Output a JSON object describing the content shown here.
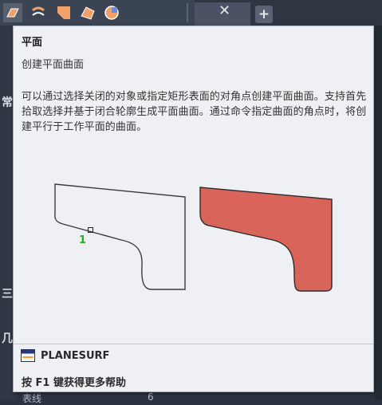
{
  "tooltip": {
    "title": "平面",
    "subtitle": "创建平面曲面",
    "description": "可以通过选择关闭的对象或指定矩形表面的对角点创建平面曲面。支持首先拾取选择并基于闭合轮廓生成平面曲面。通过命令指定曲面的角点时，将创建平行于工作平面的曲面。",
    "illustration_label": "1",
    "command_name": "PLANESURF",
    "help_text": "按 F1 键获得更多帮助"
  },
  "background": {
    "left_labels": [
      "常",
      "三",
      "几"
    ],
    "bottom_text": "表线",
    "bottom_num": "6"
  },
  "colors": {
    "tooltip_bg": "#eff0f3",
    "surface_fill": "#d9645a",
    "marker_green": "#2ea82e",
    "app_bg": "#2b3240"
  },
  "icons": [
    "planar-surface-tool-icon",
    "blend-tool-icon",
    "patch-tool-icon",
    "offset-tool-icon",
    "surface-network-icon",
    "close-tab-icon",
    "add-tab-icon",
    "command-icon"
  ]
}
